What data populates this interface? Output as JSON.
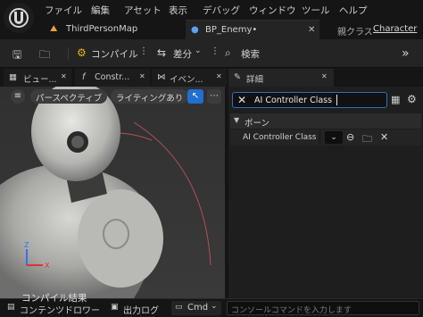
{
  "menu": {
    "items": [
      "ファイル",
      "編集",
      "アセット",
      "表示",
      "デバッグ",
      "ウィンドウ",
      "ツール",
      "ヘルプ"
    ]
  },
  "tabs": {
    "map_tab": "ThirdPersonMap",
    "blueprint_tab": "BP_Enemy•",
    "parent_class_label": "親クラス",
    "parent_class_value": "Character"
  },
  "toolbar": {
    "compile_label": "コンパイル",
    "diff_label": "差分",
    "search_label": "検索"
  },
  "panel_tabs": {
    "viewport": "ビュー...",
    "construction": "Constr...",
    "event": "イベン...",
    "details": "詳細"
  },
  "viewport_toolbar": {
    "perspective": "パースペクティブ",
    "lighting": "ライティングあり"
  },
  "viewport_axes": {
    "z": "Z",
    "x": "X"
  },
  "details": {
    "search_value": "AI Controller Class",
    "category": "ポーン",
    "property_label": "AI Controller Class"
  },
  "bottom": {
    "compile_results": "コンパイル結果",
    "content_drawer": "コンテンツドロワー",
    "output_log": "出力ログ",
    "cmd_label": "Cmd",
    "console_placeholder": "コンソールコマンドを入力します"
  },
  "colors": {
    "accent_blue": "#1e6fd1",
    "compile_yellow": "#e8b400",
    "search_border": "#2d6fc3"
  }
}
